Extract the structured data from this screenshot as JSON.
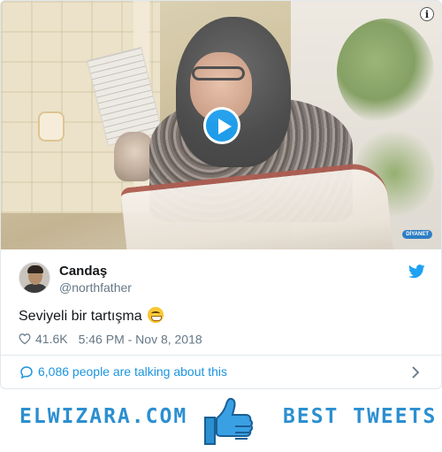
{
  "tweet": {
    "author_name": "Candaş",
    "author_handle": "@northfather",
    "text": "Seviyeli bir tartışma",
    "emoji": "grinning-face-with-smiling-eyes",
    "likes": "41.6K",
    "timestamp": "5:46 PM - Nov 8, 2018",
    "talking": "6,086 people are talking about this"
  },
  "media": {
    "type": "video",
    "info_glyph": "i",
    "channel_logo": "DİYANET"
  },
  "banner": {
    "left_text": "ELWIZARA.COM",
    "right_text": "BEST TWEETS"
  },
  "colors": {
    "twitter_blue": "#1da1f2",
    "link_blue": "#1b95e0",
    "banner_blue": "#2b8fd0",
    "secondary_text": "#657786",
    "primary_text": "#14171a",
    "border": "#e1e8ed"
  },
  "icons": [
    "info-icon",
    "play-icon",
    "twitter-bird-icon",
    "heart-icon",
    "chat-bubble-icon",
    "chevron-right-icon",
    "thumbs-up-icon"
  ]
}
